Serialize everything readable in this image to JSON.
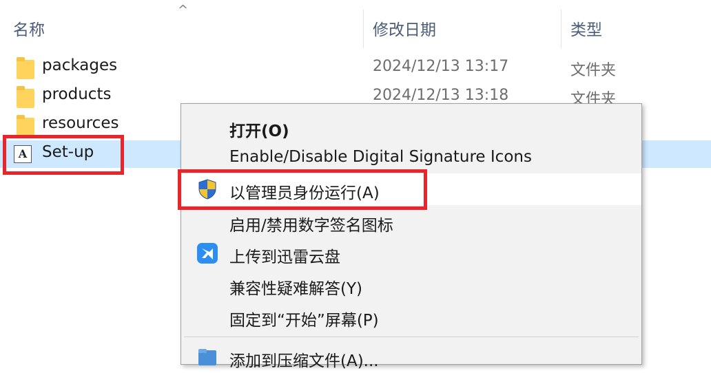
{
  "columns": {
    "name": "名称",
    "date": "修改日期",
    "type": "类型",
    "sort_indicator": "^"
  },
  "files": [
    {
      "name": "packages",
      "date": "2024/12/13 13:17",
      "type": "文件夹",
      "icon": "folder-icon"
    },
    {
      "name": "products",
      "date": "2024/12/13 13:18",
      "type": "文件夹",
      "icon": "folder-icon"
    },
    {
      "name": "resources",
      "date": "",
      "type": "",
      "icon": "folder-icon"
    },
    {
      "name": "Set-up",
      "date": "",
      "type": "",
      "icon": "adobe-icon",
      "selected": true
    }
  ],
  "adobe_icon_glyph": "A",
  "context_menu": {
    "items": [
      {
        "label": "打开(O)",
        "bold": true
      },
      {
        "label": "Enable/Disable Digital Signature Icons"
      },
      {
        "label": "以管理员身份运行(A)",
        "icon": "uac-shield-icon",
        "hover": true
      },
      {
        "label": "启用/禁用数字签名图标"
      },
      {
        "label": "上传到迅雷云盘",
        "icon": "xunlei-icon"
      },
      {
        "label": "兼容性疑难解答(Y)"
      },
      {
        "label": "固定到“开始”屏幕(P)"
      },
      {
        "label": "添加到压缩文件(A)...",
        "icon": "archive-icon"
      }
    ]
  },
  "colors": {
    "selection": "#cde8ff",
    "highlight_box": "#e8252b",
    "menu_bg": "#f2f2f2"
  }
}
